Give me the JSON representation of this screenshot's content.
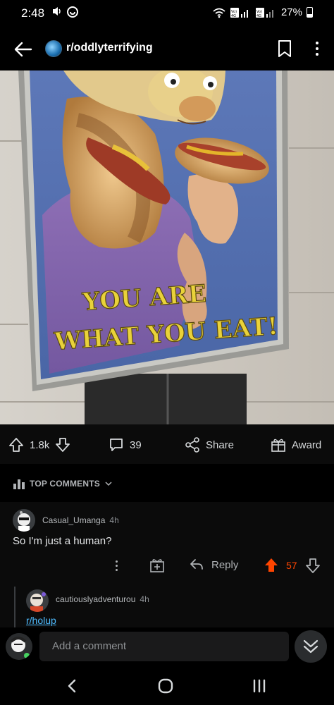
{
  "status_bar": {
    "time": "2:48",
    "signal_labels": [
      "Vo) LTE1",
      "Vo) LTE2"
    ],
    "network": "4G",
    "battery": "27%"
  },
  "header": {
    "subreddit": "r/oddlyterrifying",
    "icons": [
      "back-arrow-icon",
      "bookmark-icon",
      "more-vertical-icon"
    ]
  },
  "post_image": {
    "poster_text": [
      "YOU ARE",
      "WHAT YOU EAT!"
    ]
  },
  "actions": {
    "votes": "1.8k",
    "comments": "39",
    "share_label": "Share",
    "award_label": "Award"
  },
  "section": {
    "label": "TOP COMMENTS"
  },
  "comments": [
    {
      "user": "Casual_Umanga",
      "time": "4h",
      "body": "So I'm just a human?",
      "reply_label": "Reply",
      "score": "57"
    },
    {
      "user": "cautiouslyadventurou",
      "time": "4h",
      "body": "r/holup"
    }
  ],
  "composer": {
    "placeholder": "Add a comment"
  },
  "colors": {
    "background": "#000000",
    "surface": "#0b0b0b",
    "upvote_active": "#ff4500",
    "link": "#4fbcff"
  }
}
